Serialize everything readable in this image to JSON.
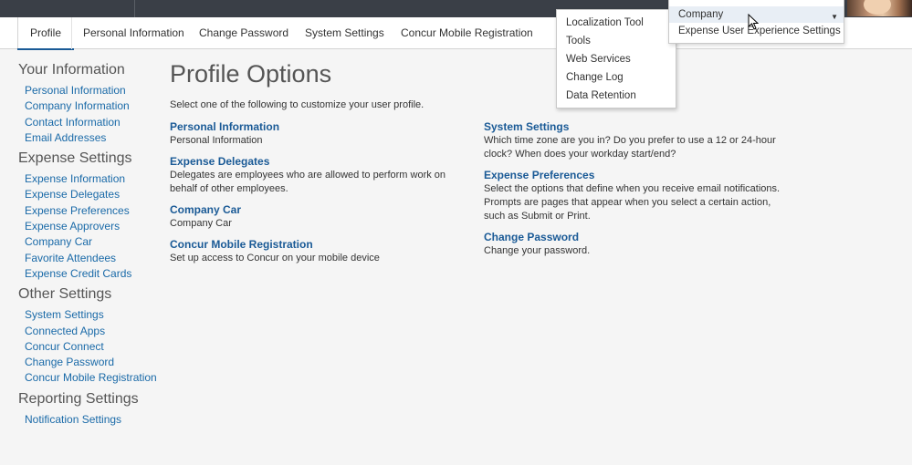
{
  "tabs": [
    {
      "label": "Profile",
      "active": true
    },
    {
      "label": "Personal Information",
      "active": false
    },
    {
      "label": "Change Password",
      "active": false
    },
    {
      "label": "System Settings",
      "active": false
    },
    {
      "label": "Concur Mobile Registration",
      "active": false
    }
  ],
  "sidebar": {
    "your_information": {
      "heading": "Your Information",
      "links": [
        "Personal Information",
        "Company Information",
        "Contact Information",
        "Email Addresses"
      ]
    },
    "expense_settings": {
      "heading": "Expense Settings",
      "links": [
        "Expense Information",
        "Expense Delegates",
        "Expense Preferences",
        "Expense Approvers",
        "Company Car",
        "Favorite Attendees",
        "Expense Credit Cards"
      ]
    },
    "other_settings": {
      "heading": "Other Settings",
      "links": [
        "System Settings",
        "Connected Apps",
        "Concur Connect",
        "Change Password",
        "Concur Mobile Registration"
      ]
    },
    "reporting_settings": {
      "heading": "Reporting Settings",
      "links": [
        "Notification Settings"
      ]
    }
  },
  "main": {
    "title": "Profile Options",
    "intro": "Select one of the following to customize your user profile.",
    "left_options": [
      {
        "title": "Personal Information",
        "desc": "Personal Information"
      },
      {
        "title": "Expense Delegates",
        "desc": "Delegates are employees who are allowed to perform work on behalf of other employees."
      },
      {
        "title": "Company Car",
        "desc": "Company Car"
      },
      {
        "title": "Concur Mobile Registration",
        "desc": "Set up access to Concur on your mobile device"
      }
    ],
    "right_options": [
      {
        "title": "System Settings",
        "desc": "Which time zone are you in? Do you prefer to use a 12 or 24-hour clock? When does your workday start/end?"
      },
      {
        "title": "Expense Preferences",
        "desc": "Select the options that define when you receive email notifications. Prompts are pages that appear when you select a certain action, such as Submit or Print."
      },
      {
        "title": "Change Password",
        "desc": "Change your password."
      }
    ]
  },
  "dropdown": {
    "items": [
      "Localization Tool",
      "Tools",
      "Web Services",
      "Change Log",
      "Data Retention"
    ]
  },
  "admin_menu": {
    "company": "Company",
    "expense_ux": "Expense User Experience Settings"
  },
  "colors": {
    "link": "#1a6aa8",
    "heading_link": "#1a5a96",
    "topbar": "#3a3f47",
    "active_tab_underline": "#1a5a96"
  }
}
